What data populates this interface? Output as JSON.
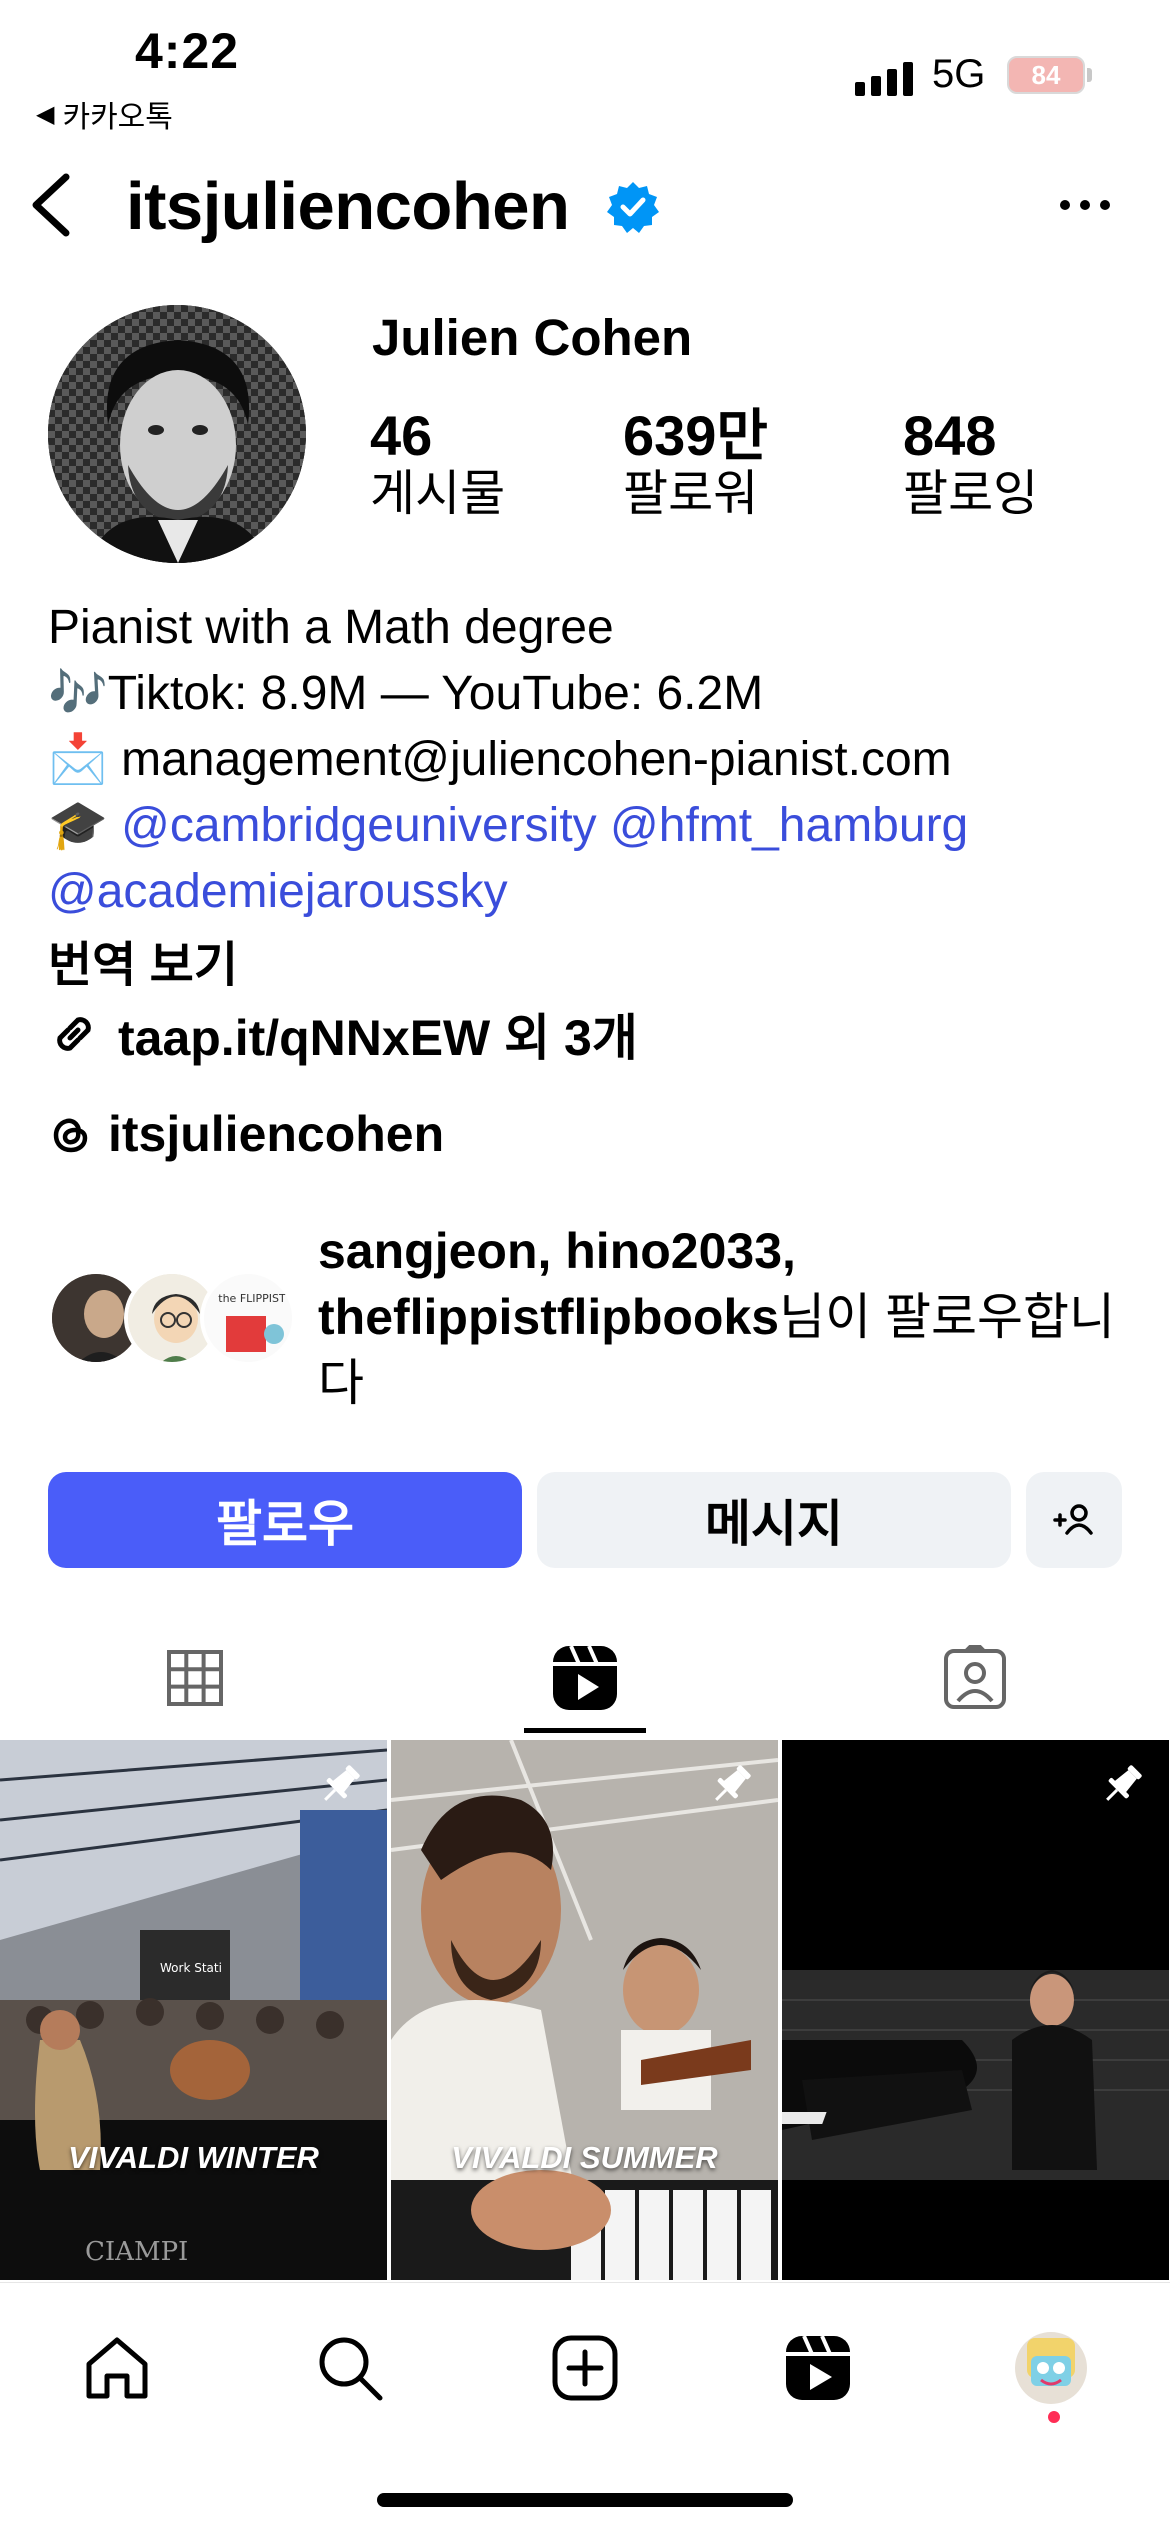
{
  "status_bar": {
    "time": "4:22",
    "back_app": "카카오톡",
    "network": "5G",
    "battery": "84"
  },
  "header": {
    "username": "itsjuliencohen",
    "verified": true
  },
  "profile": {
    "display_name": "Julien Cohen",
    "stats": [
      {
        "value": "46",
        "label": "게시물"
      },
      {
        "value": "639만",
        "label": "팔로워"
      },
      {
        "value": "848",
        "label": "팔로잉"
      }
    ]
  },
  "bio": {
    "line1": "Pianist with a Math degree",
    "line2": "🎶Tiktok: 8.9M — YouTube: 6.2M",
    "line3_icon": "📩",
    "line3": "management@juliencohen-pianist.com",
    "line4_icon": "🎓",
    "mention1": "@cambridgeuniversity",
    "mention2": "@hfmt_hamburg",
    "mention3": "@academiejaroussky",
    "translate": "번역 보기",
    "link": "taap.it/qNNxEW 외 3개",
    "threads": "itsjuliencohen"
  },
  "followed_by": {
    "names": "sangjeon, hino2033, theflippistflipbooks",
    "suffix": "님이 팔로우합니다",
    "mutual_avatar_text": "the FLIPPIST"
  },
  "actions": {
    "follow": "팔로우",
    "message": "메시지"
  },
  "tabs": [
    "grid-icon",
    "reels-icon",
    "tagged-icon"
  ],
  "active_tab": "reels",
  "reels": [
    {
      "caption": "VIVALDI WINTER",
      "piano_brand": "CIAMPI",
      "sign": "Work Stati",
      "pinned": true
    },
    {
      "caption": "VIVALDI SUMMER",
      "pinned": true
    },
    {
      "caption": "",
      "pinned": true
    }
  ],
  "bottom_nav": [
    "home-icon",
    "search-icon",
    "create-icon",
    "reels-icon",
    "profile-avatar"
  ],
  "colors": {
    "follow_button": "#4a5df9",
    "link": "#3a4ddb",
    "verified": "#0095f6",
    "secondary_button": "#eff2f5"
  }
}
